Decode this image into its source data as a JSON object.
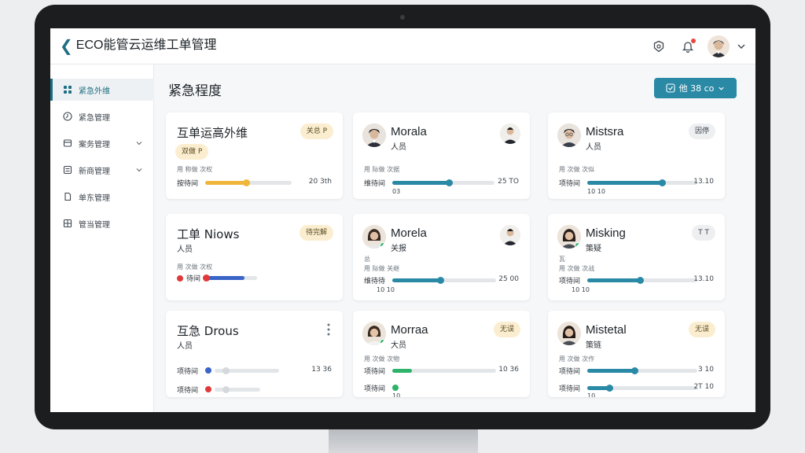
{
  "header": {
    "brand_chevron": "❮",
    "title": "ECO能管云运维工单管理",
    "icons": [
      "settings-shield-icon",
      "bell-icon",
      "user-avatar",
      "chevron-down-icon"
    ]
  },
  "sidebar": {
    "items": [
      {
        "label": "紧急外维",
        "icon": "grid-icon",
        "active": true
      },
      {
        "label": "紧急管理",
        "icon": "clock-icon"
      },
      {
        "label": "案务管理",
        "icon": "box-icon",
        "expandable": true
      },
      {
        "label": "新商管理",
        "icon": "list-icon",
        "expandable": true
      },
      {
        "label": "单东管理",
        "icon": "document-icon"
      },
      {
        "label": "管当管理",
        "icon": "apps-icon"
      }
    ]
  },
  "main": {
    "title": "紧急程度",
    "filter_button": "他 38 co"
  },
  "cards": [
    {
      "title": "互单运高外维",
      "badge": "关总 P",
      "chip": "双做 P",
      "meta": "用 称做 次权",
      "rows": [
        {
          "label": "按待间",
          "value": "20 3th",
          "progress": 0.47
        }
      ]
    },
    {
      "name": "Morala",
      "sub": "人员",
      "meta": "用 际做 次据",
      "rows": [
        {
          "label": "维待间",
          "value": "25 TO",
          "progress": 0.55,
          "sub": "03"
        }
      ]
    },
    {
      "name": "Mistsra",
      "sub": "人员",
      "badge": "因停",
      "meta": "用 次做 次似",
      "rows": [
        {
          "label": "项待间",
          "value": "13.10",
          "progress": 0.68,
          "sub": "10  10"
        }
      ]
    },
    {
      "title": "工单 Niows",
      "sub": "人员",
      "badge": "待完解",
      "meta": "用 次做 次权",
      "rows": [
        {
          "label": "待间",
          "value": "",
          "progress": 0.75
        }
      ]
    },
    {
      "name": "Morela",
      "sub": "关报",
      "meta2": "总",
      "meta": "用 际做 关继",
      "rows": [
        {
          "label": "维待待",
          "value": "25 00",
          "progress": 0.46,
          "sub": "10  10"
        }
      ]
    },
    {
      "name": "Misking",
      "sub": "策疑",
      "badge": "T T",
      "meta2": "瓦",
      "meta": "用 次做 次战",
      "rows": [
        {
          "label": "项待间",
          "value": "13.10",
          "progress": 0.48,
          "sub": "10  10"
        }
      ]
    },
    {
      "title": "互急 Drous",
      "sub": "人员",
      "rows": [
        {
          "label": "项待间",
          "value": "13 36",
          "progress": 0.0
        },
        {
          "label": "项待间",
          "value": "",
          "progress": 0.0
        }
      ]
    },
    {
      "name": "Morraa",
      "sub": "大员",
      "badge": "无误",
      "meta": "用 次做 次物",
      "rows": [
        {
          "label": "项待间",
          "value": "10 36",
          "progress": 0.19
        },
        {
          "label": "项待间",
          "value": "",
          "progress": 0.0,
          "sub": "10"
        }
      ]
    },
    {
      "name": "Mistetal",
      "sub": "策链",
      "badge": "无误",
      "meta": "用 次做 次作",
      "rows": [
        {
          "label": "项待间",
          "value": "3 10",
          "progress": 0.43
        },
        {
          "label": "项待间",
          "value": "2T 10",
          "progress": 0.2,
          "sub": "10"
        }
      ]
    }
  ],
  "colors": {
    "accent": "#1f6f84",
    "button": "#2a8aa6",
    "teal_bar": "#2a8aa6",
    "yellow_bar": "#f0b63c",
    "blue_bar": "#3a64c8",
    "green_bar": "#2fb36a",
    "red_dot": "#e0393a",
    "blue_dot": "#3a64c8"
  }
}
